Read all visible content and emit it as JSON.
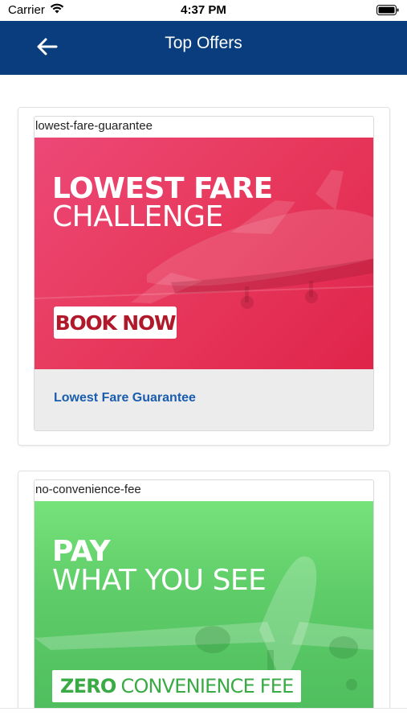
{
  "status_bar": {
    "carrier": "Carrier",
    "time": "4:37 PM"
  },
  "nav": {
    "title": "Top Offers"
  },
  "offers": [
    {
      "alt_text": "lowest-fare-guarantee",
      "banner_line1": "LOWEST FARE",
      "banner_line2": "CHALLENGE",
      "cta": "BOOK NOW",
      "title": "Lowest Fare Guarantee",
      "color": "#e8375c"
    },
    {
      "alt_text": "no-convenience-fee",
      "banner_line1": "PAY",
      "banner_line2": "WHAT YOU SEE",
      "cta_bold": "ZERO",
      "cta_rest": "CONVENIENCE FEE",
      "color": "#5ecc68"
    }
  ],
  "colors": {
    "nav_background": "#0a3d7e",
    "offer_title": "#1a5cad"
  }
}
